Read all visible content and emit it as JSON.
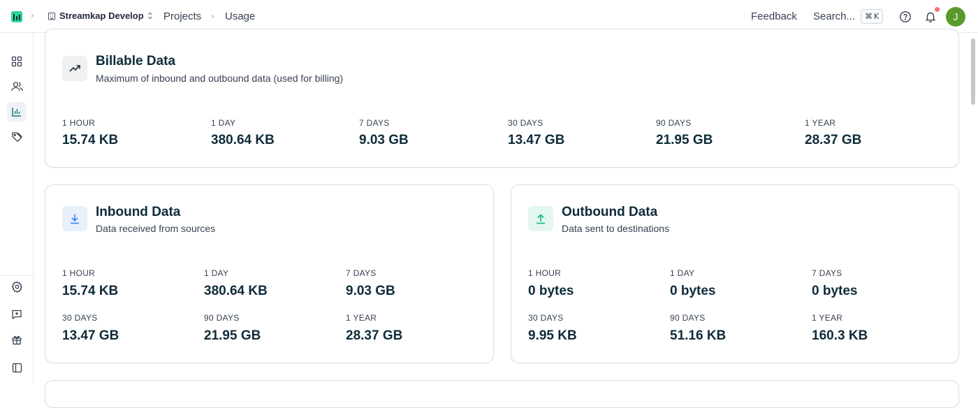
{
  "header": {
    "workspace": "Streamkap Develop",
    "breadcrumbs": [
      "Projects",
      "Usage"
    ],
    "feedback": "Feedback",
    "search": "Search...",
    "shortcut_cmd": "⌘",
    "shortcut_key": "K",
    "avatar_initial": "J",
    "accent_color": "#2bd49a"
  },
  "sidebar": {
    "items": [
      {
        "icon": "dashboard-icon"
      },
      {
        "icon": "users-icon"
      },
      {
        "icon": "usage-chart-icon",
        "active": true
      },
      {
        "icon": "tags-icon"
      }
    ],
    "bottom_items": [
      {
        "icon": "settings-gear-icon"
      },
      {
        "icon": "feedback-message-icon"
      },
      {
        "icon": "gift-icon"
      },
      {
        "icon": "sidebar-toggle-icon"
      }
    ]
  },
  "billable": {
    "title": "Billable Data",
    "subtitle": "Maximum of inbound and outbound data (used for billing)",
    "stats": [
      {
        "label": "1 HOUR",
        "value": "15.74 KB"
      },
      {
        "label": "1 DAY",
        "value": "380.64 KB"
      },
      {
        "label": "7 DAYS",
        "value": "9.03 GB"
      },
      {
        "label": "30 DAYS",
        "value": "13.47 GB"
      },
      {
        "label": "90 DAYS",
        "value": "21.95 GB"
      },
      {
        "label": "1 YEAR",
        "value": "28.37 GB"
      }
    ]
  },
  "inbound": {
    "title": "Inbound Data",
    "subtitle": "Data received from sources",
    "stats": [
      {
        "label": "1 HOUR",
        "value": "15.74 KB"
      },
      {
        "label": "1 DAY",
        "value": "380.64 KB"
      },
      {
        "label": "7 DAYS",
        "value": "9.03 GB"
      },
      {
        "label": "30 DAYS",
        "value": "13.47 GB"
      },
      {
        "label": "90 DAYS",
        "value": "21.95 GB"
      },
      {
        "label": "1 YEAR",
        "value": "28.37 GB"
      }
    ]
  },
  "outbound": {
    "title": "Outbound Data",
    "subtitle": "Data sent to destinations",
    "stats": [
      {
        "label": "1 HOUR",
        "value": "0 bytes"
      },
      {
        "label": "1 DAY",
        "value": "0 bytes"
      },
      {
        "label": "7 DAYS",
        "value": "0 bytes"
      },
      {
        "label": "30 DAYS",
        "value": "9.95 KB"
      },
      {
        "label": "90 DAYS",
        "value": "51.16 KB"
      },
      {
        "label": "1 YEAR",
        "value": "160.3 KB"
      }
    ]
  }
}
